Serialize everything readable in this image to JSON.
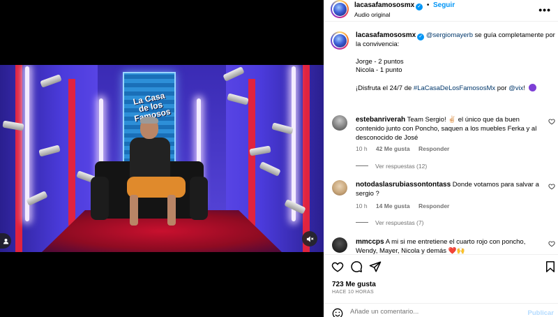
{
  "post": {
    "username": "lacasafamososmx",
    "audio": "Audio original",
    "follow_label": "Seguir",
    "more": "•••"
  },
  "caption": {
    "username": "lacasafamososmx",
    "mention": "@sergiomayerb",
    "line1": " se guía completamente por la convivencia:",
    "score1": "Jorge - 2 puntos",
    "score2": "Nicola - 1 punto",
    "tagline_pre": "¡Disfruta el 24/7 de ",
    "hashtag": "#LaCasaDeLosFamososMx",
    "tagline_mid": " por ",
    "vix": "@vix",
    "tagline_end": "!"
  },
  "poster_text": "La Casa de los Famosos",
  "comments": [
    {
      "username": "estebanriverah",
      "text": " Team Sergio! ✌🏻 el único que da buen contenido junto con Poncho, saquen a los muebles Ferka y al desconocido de José",
      "time": "10 h",
      "likes": "42 Me gusta",
      "reply": "Responder",
      "view_replies": "Ver respuestas (12)"
    },
    {
      "username": "notodaslasrubiassontontass",
      "text": " Donde votamos para salvar a sergio ?",
      "time": "10 h",
      "likes": "14 Me gusta",
      "reply": "Responder",
      "view_replies": "Ver respuestas (7)"
    },
    {
      "username": "mmccps",
      "text": " A mi si me entretiene el cuarto rojo con poncho, Wendy, Mayer, Nicola y demás ❤️🙌",
      "time": "",
      "likes": "",
      "reply": "",
      "view_replies": ""
    }
  ],
  "actions": {
    "likes": "723 Me gusta",
    "time": "HACE 10 HORAS"
  },
  "add_comment": {
    "placeholder": "Añade un comentario...",
    "publish": "Publicar"
  },
  "colors": {
    "accent": "#0095f6",
    "link": "#00376b",
    "muted": "#737373"
  }
}
